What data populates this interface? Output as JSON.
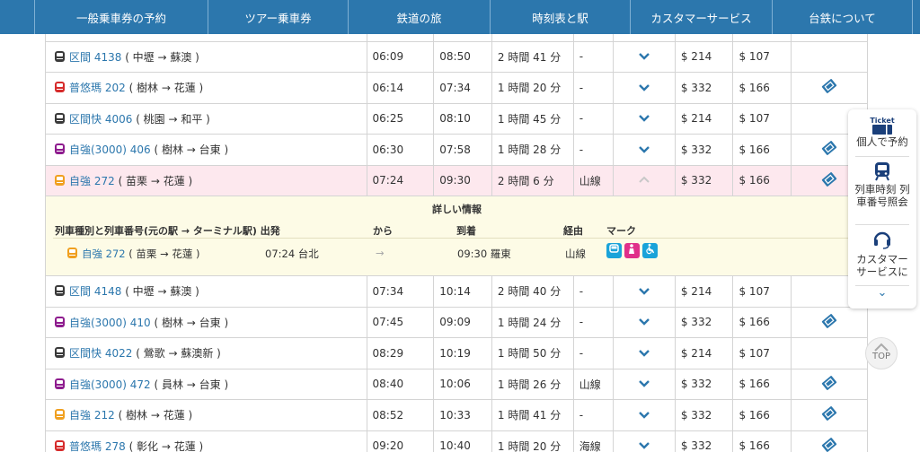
{
  "nav": {
    "items": [
      {
        "label": "一般乗車券の予約"
      },
      {
        "label": "ツアー乗車券"
      },
      {
        "label": "鉄道の旅"
      },
      {
        "label": "時刻表と駅"
      },
      {
        "label": "カスタマーサービス"
      },
      {
        "label": "台鉄について"
      }
    ]
  },
  "colors": {
    "nav_bg": "#2c77ad",
    "link": "#2c77ad",
    "highlight_row": "#fde8ee",
    "detail_bg": "#fdfbe6",
    "local": "#3a3a3a",
    "puyuma": "#d62b2b",
    "tze_chiang": "#f0a020",
    "tze_chiang_3000": "#8e1c8e"
  },
  "icons": {
    "expand": "chevron-down-icon",
    "collapse": "chevron-up-icon",
    "ticket": "ticket-icon",
    "train": "train-icon"
  },
  "rows": [
    {
      "type_color": "#3a3a3a",
      "train": "区間 4138",
      "route": "( 中壢 → 蘇澳 )",
      "dep": "06:09",
      "arr": "08:50",
      "dur": "2 時間 41 分",
      "via": "-",
      "adult": "$ 214",
      "child": "$ 107",
      "ticket": false
    },
    {
      "type_color": "#d62b2b",
      "train": "普悠瑪 202",
      "route": "( 樹林 → 花蓮 )",
      "dep": "06:14",
      "arr": "07:34",
      "dur": "1 時間 20 分",
      "via": "-",
      "adult": "$ 332",
      "child": "$ 166",
      "ticket": true
    },
    {
      "type_color": "#3a3a3a",
      "train": "区間快 4006",
      "route": "( 桃園 → 和平 )",
      "dep": "06:25",
      "arr": "08:10",
      "dur": "1 時間 45 分",
      "via": "-",
      "adult": "$ 214",
      "child": "$ 107",
      "ticket": false
    },
    {
      "type_color": "#8e1c8e",
      "train": "自強(3000) 406",
      "route": "( 樹林 → 台東 )",
      "dep": "06:30",
      "arr": "07:58",
      "dur": "1 時間 28 分",
      "via": "-",
      "adult": "$ 332",
      "child": "$ 166",
      "ticket": true
    },
    {
      "type_color": "#f0a020",
      "train": "自強 272",
      "route": "( 苗栗 → 花蓮 )",
      "dep": "07:24",
      "arr": "09:30",
      "dur": "2 時間 6 分",
      "via": "山線",
      "adult": "$ 332",
      "child": "$ 166",
      "ticket": true,
      "expanded": true
    }
  ],
  "detail": {
    "title": "詳しい情報",
    "headers": {
      "train": "列車種別と列車番号(元の駅 → ターミナル駅) 出発",
      "from": "から",
      "arrive": "到着",
      "via": "経由",
      "mark": "マーク"
    },
    "row": {
      "train": "自強 272",
      "route": "( 苗栗 → 花蓮 )",
      "dep": "07:24 台北",
      "arrow": "→",
      "arr": "09:30 羅東",
      "via": "山線"
    },
    "marks": [
      {
        "name": "dining-car-icon",
        "color": "#1aa3d9"
      },
      {
        "name": "nursing-room-icon",
        "color": "#e0308a"
      },
      {
        "name": "wheelchair-icon",
        "color": "#1aa3d9"
      }
    ]
  },
  "rows2": [
    {
      "type_color": "#3a3a3a",
      "train": "区間 4148",
      "route": "( 中壢 → 蘇澳 )",
      "dep": "07:34",
      "arr": "10:14",
      "dur": "2 時間 40 分",
      "via": "-",
      "adult": "$ 214",
      "child": "$ 107",
      "ticket": false
    },
    {
      "type_color": "#8e1c8e",
      "train": "自強(3000) 410",
      "route": "( 樹林 → 台東 )",
      "dep": "07:45",
      "arr": "09:09",
      "dur": "1 時間 24 分",
      "via": "-",
      "adult": "$ 332",
      "child": "$ 166",
      "ticket": true
    },
    {
      "type_color": "#3a3a3a",
      "train": "区間快 4022",
      "route": "( 鶯歌 → 蘇澳新 )",
      "dep": "08:29",
      "arr": "10:19",
      "dur": "1 時間 50 分",
      "via": "-",
      "adult": "$ 214",
      "child": "$ 107",
      "ticket": false
    },
    {
      "type_color": "#8e1c8e",
      "train": "自強(3000) 472",
      "route": "( 員林 → 台東 )",
      "dep": "08:40",
      "arr": "10:06",
      "dur": "1 時間 26 分",
      "via": "山線",
      "adult": "$ 332",
      "child": "$ 166",
      "ticket": true
    },
    {
      "type_color": "#f0a020",
      "train": "自強 212",
      "route": "( 樹林 → 花蓮 )",
      "dep": "08:52",
      "arr": "10:33",
      "dur": "1 時間 41 分",
      "via": "-",
      "adult": "$ 332",
      "child": "$ 166",
      "ticket": true
    },
    {
      "type_color": "#d62b2b",
      "train": "普悠瑪 278",
      "route": "( 彰化 → 花蓮 )",
      "dep": "09:20",
      "arr": "10:40",
      "dur": "1 時間 20 分",
      "via": "海線",
      "adult": "$ 332",
      "child": "$ 166",
      "ticket": true
    }
  ],
  "side": {
    "ticket_tag": "Ticket",
    "book_label": "個人で予約",
    "timetable_label": "列車時刻 列車番号照会",
    "service_label": "カスタマー サービスに",
    "more": "⌄"
  },
  "top_button": "TOP"
}
